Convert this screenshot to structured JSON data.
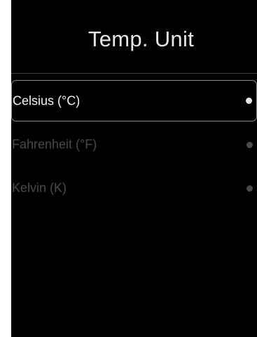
{
  "header": {
    "title": "Temp. Unit"
  },
  "options": [
    {
      "label": "Celsius (°C)",
      "selected": true
    },
    {
      "label": "Fahrenheit (°F)",
      "selected": false
    },
    {
      "label": "Kelvin (K)",
      "selected": false
    }
  ],
  "colors": {
    "background": "#000000",
    "selected_text": "#f2f2f2",
    "unselected_text": "#4a4a4a",
    "selected_border": "#8a8a8a"
  }
}
